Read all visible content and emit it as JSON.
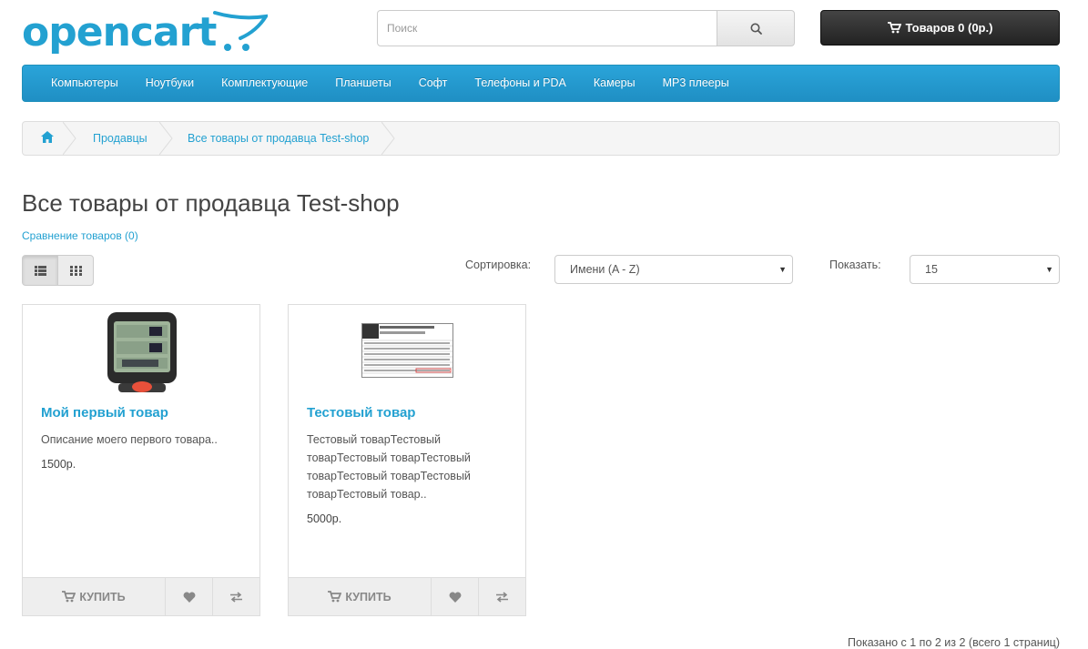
{
  "header": {
    "logo_text": "opencart",
    "search_placeholder": "Поиск",
    "cart_label": "Товаров 0 (0р.)"
  },
  "menu": {
    "items": [
      {
        "label": "Компьютеры"
      },
      {
        "label": "Ноутбуки"
      },
      {
        "label": "Комплектующие"
      },
      {
        "label": "Планшеты"
      },
      {
        "label": "Софт"
      },
      {
        "label": "Телефоны и PDA"
      },
      {
        "label": "Камеры"
      },
      {
        "label": "MP3 плееры"
      }
    ]
  },
  "breadcrumb": {
    "items": [
      {
        "label": "Продавцы"
      },
      {
        "label": "Все товары от продавца Test-shop"
      }
    ]
  },
  "page": {
    "title": "Все товары от продавца Test-shop",
    "compare_link": "Сравнение товаров (0)"
  },
  "controls": {
    "sort_label": "Сортировка:",
    "sort_value": "Имени (A - Z)",
    "limit_label": "Показать:",
    "limit_value": "15"
  },
  "products": [
    {
      "name": "Мой первый товар",
      "description": "Описание моего первого товара..",
      "price": "1500р.",
      "buy_label": "КУПИТЬ",
      "image_icon": "bike-computer-image"
    },
    {
      "name": "Тестовый товар",
      "description": "Тестовый товарТестовый товарТестовый товарТестовый товарТестовый товарТестовый товарТестовый товар..",
      "price": "5000р.",
      "buy_label": "КУПИТЬ",
      "image_icon": "table-document-image"
    }
  ],
  "pagination": {
    "info": "Показано с 1 по 2 из 2 (всего 1 страниц)"
  },
  "colors": {
    "brand": "#23a1d1",
    "menu_bg": "#229ac8",
    "cart_bg": "#303030"
  }
}
